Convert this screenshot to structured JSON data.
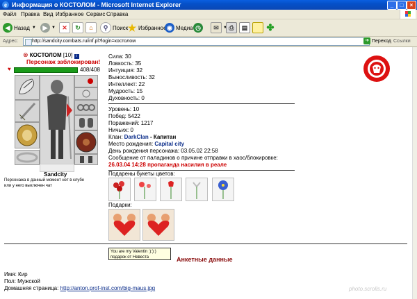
{
  "window": {
    "title": "Информация о КОСТОЛОМ - Microsoft Internet Explorer",
    "controls": {
      "minimize": "_",
      "maximize": "□",
      "close": "×"
    }
  },
  "menu": [
    "Файл",
    "Правка",
    "Вид",
    "Избранное",
    "Сервис",
    "Справка"
  ],
  "toolbar": {
    "back": "Назад",
    "search": "Поиск",
    "favorites": "Избранное",
    "media": "Медиа"
  },
  "address": {
    "label": "Адрес:",
    "value": "http://sandcity.combats.ru/inf.pl?login=костолом",
    "go": "Переход",
    "links": "Ссылки"
  },
  "character": {
    "name": "КОСТОЛОМ",
    "level": "[10]",
    "blocked": "Персонаж заблокирован!",
    "hp": "408/408",
    "hp_fraction": 1.0,
    "city": "Sandcity",
    "status_note_line1": "Персонажа в данный момент нет в клубе",
    "status_note_line2": "или у него выключен чат"
  },
  "stats": [
    "Сила: 30",
    "Ловкость: 35",
    "Интуиция: 32",
    "Выносливость: 32",
    "Интеллект: 22",
    "Мудрость: 15",
    "Духовность: 0"
  ],
  "info": {
    "level": "Уровень: 10",
    "wins": "Побед: 5422",
    "losses": "Поражений: 1217",
    "draws": "Ничьих: 0",
    "clan_label": "Клан:",
    "clan_name": "DarkClan",
    "clan_rank": " - Капитан",
    "birthplace_label": "Место рождения:",
    "birthplace_value": "Capital city",
    "birthday": "День рождения персонажа: 03.05.02 22:58",
    "paladin_message": "Сообщение от паладинов о причине отправки в хаос/блокировке:",
    "block_date": "26.03.04 14:28",
    "block_reason": "пропаганда насилия в реале"
  },
  "flowers_label": "Подарены букеты цветов:",
  "gifts_label": "Подарки:",
  "tooltip": {
    "line1": "You are my Valentin :):):)",
    "line2": "подарок от Невеста"
  },
  "profile": {
    "section_title": "Анкетные данные",
    "name": "Имя: Кир",
    "gender": "Пол: Мужской",
    "homepage_label": "Домашняя страница:",
    "homepage_url": "http://anton.prof-inst.com/big-maus.jpg"
  },
  "watermark": "photo.scrolls.ru",
  "colors": {
    "blocked": "#cc0000",
    "clan": "#0b2d8a",
    "hp_bar": "#1a9b1a",
    "logo": "#dd1111",
    "title_bar": "#0550c8"
  }
}
